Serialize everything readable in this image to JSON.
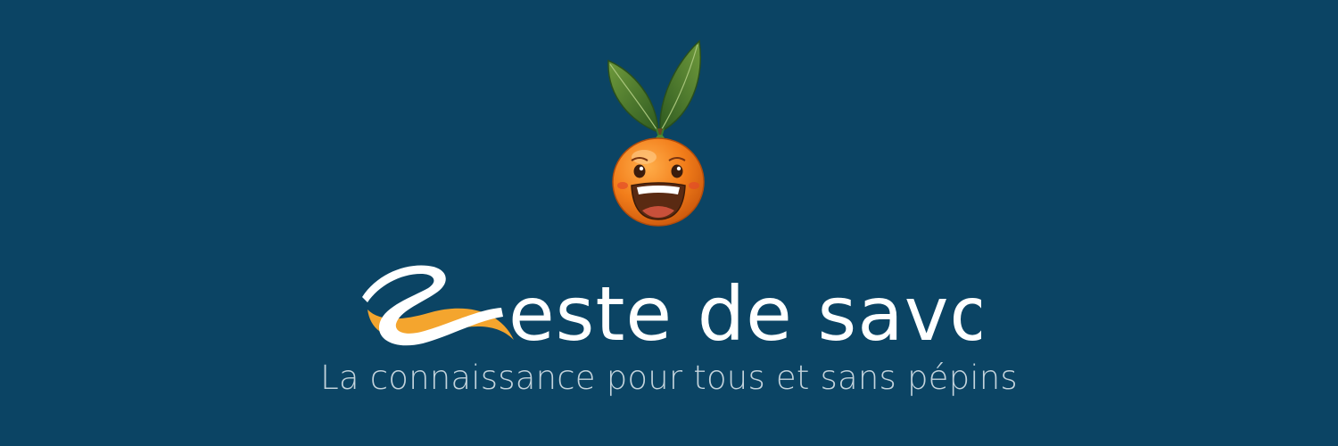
{
  "banner": {
    "background_color": "#0b4464",
    "accent_orange": "#f4a52e",
    "wordmark_color": "#ffffff",
    "tagline_color": "#c3d3dc"
  },
  "mascot": {
    "icon": "orange-mascot-icon",
    "description_colors": {
      "fruit": "#f07f1c",
      "leaf": "#4c7a2c",
      "mouth": "#5a2a12"
    }
  },
  "logo": {
    "wordmark_text": "zeste de savoir",
    "icon": "zds-logo-icon"
  },
  "tagline": {
    "text": "La connaissance pour tous et sans pépins"
  }
}
